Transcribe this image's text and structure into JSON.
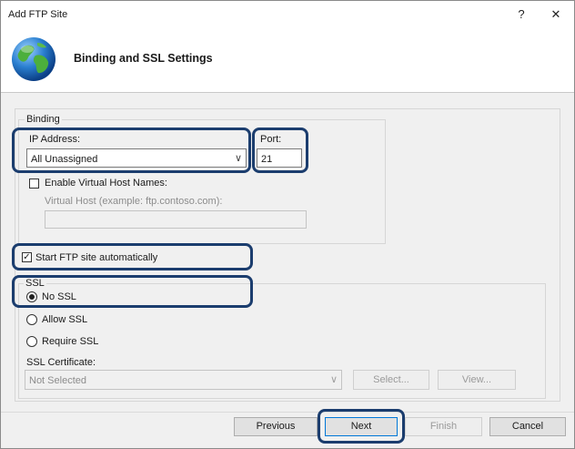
{
  "window": {
    "title": "Add FTP Site",
    "help_glyph": "?",
    "close_glyph": "✕"
  },
  "header": {
    "title": "Binding and SSL Settings"
  },
  "binding": {
    "legend": "Binding",
    "ip_label": "IP Address:",
    "ip_value": "All Unassigned",
    "port_label": "Port:",
    "port_value": "21",
    "virtual_host_checkbox_label": "Enable Virtual Host Names:",
    "virtual_host_checked": false,
    "virtual_host_label": "Virtual Host (example: ftp.contoso.com):",
    "virtual_host_value": ""
  },
  "start_auto": {
    "label": "Start FTP site automatically",
    "checked": true
  },
  "ssl": {
    "legend": "SSL",
    "options": [
      "No SSL",
      "Allow SSL",
      "Require SSL"
    ],
    "selected": "No SSL",
    "certificate_label": "SSL Certificate:",
    "certificate_value": "Not Selected",
    "select_button": "Select...",
    "view_button": "View..."
  },
  "footer": {
    "previous": "Previous",
    "next": "Next",
    "finish": "Finish",
    "cancel": "Cancel"
  },
  "colors": {
    "highlight": "#1b3d6e",
    "dialog_bg": "#f0f0f0"
  }
}
